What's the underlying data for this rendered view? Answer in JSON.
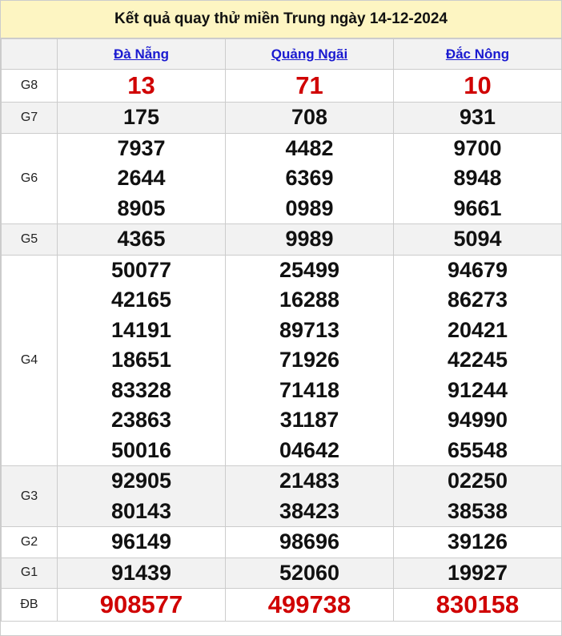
{
  "title": "Kết quả quay thử miền Trung ngày 14-12-2024",
  "provinces": [
    "Đà Nẵng",
    "Quảng Ngãi",
    "Đắc Nông"
  ],
  "rows": [
    {
      "label": "G8",
      "values": [
        [
          "13"
        ],
        [
          "71"
        ],
        [
          "10"
        ]
      ],
      "highlight": true
    },
    {
      "label": "G7",
      "values": [
        [
          "175"
        ],
        [
          "708"
        ],
        [
          "931"
        ]
      ]
    },
    {
      "label": "G6",
      "values": [
        [
          "7937",
          "2644",
          "8905"
        ],
        [
          "4482",
          "6369",
          "0989"
        ],
        [
          "9700",
          "8948",
          "9661"
        ]
      ]
    },
    {
      "label": "G5",
      "values": [
        [
          "4365"
        ],
        [
          "9989"
        ],
        [
          "5094"
        ]
      ]
    },
    {
      "label": "G4",
      "values": [
        [
          "50077",
          "42165",
          "14191",
          "18651",
          "83328",
          "23863",
          "50016"
        ],
        [
          "25499",
          "16288",
          "89713",
          "71926",
          "71418",
          "31187",
          "04642"
        ],
        [
          "94679",
          "86273",
          "20421",
          "42245",
          "91244",
          "94990",
          "65548"
        ]
      ]
    },
    {
      "label": "G3",
      "values": [
        [
          "92905",
          "80143"
        ],
        [
          "21483",
          "38423"
        ],
        [
          "02250",
          "38538"
        ]
      ]
    },
    {
      "label": "G2",
      "values": [
        [
          "96149"
        ],
        [
          "98696"
        ],
        [
          "39126"
        ]
      ]
    },
    {
      "label": "G1",
      "values": [
        [
          "91439"
        ],
        [
          "52060"
        ],
        [
          "19927"
        ]
      ]
    },
    {
      "label": "ĐB",
      "values": [
        [
          "908577"
        ],
        [
          "499738"
        ],
        [
          "830158"
        ]
      ],
      "highlight": true
    }
  ],
  "colors": {
    "header_bg": "#fdf5c2",
    "highlight": "#d00000",
    "link": "#1a1ad0",
    "stripe": "#f2f2f2"
  }
}
